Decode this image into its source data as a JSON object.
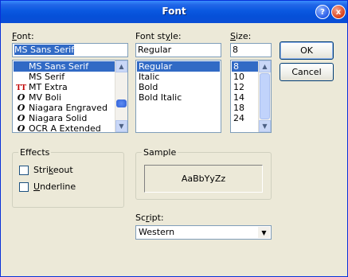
{
  "window": {
    "title": "Font",
    "help_glyph": "?",
    "close_glyph": "x"
  },
  "font": {
    "label_u": "F",
    "label_rest": "ont:",
    "value": "MS Sans Serif",
    "items": [
      {
        "name": "MS Sans Serif",
        "icon": "",
        "selected": true
      },
      {
        "name": "MS Serif",
        "icon": "",
        "selected": false
      },
      {
        "name": "MT Extra",
        "icon": "TT",
        "selected": false
      },
      {
        "name": "MV Boli",
        "icon": "O",
        "selected": false
      },
      {
        "name": "Niagara Engraved",
        "icon": "O",
        "selected": false
      },
      {
        "name": "Niagara Solid",
        "icon": "O",
        "selected": false
      },
      {
        "name": "OCR A Extended",
        "icon": "O",
        "selected": false
      }
    ]
  },
  "style": {
    "label_pre": "Font st",
    "label_u": "y",
    "label_post": "le:",
    "value": "Regular",
    "items": [
      {
        "name": "Regular",
        "selected": true
      },
      {
        "name": "Italic",
        "selected": false
      },
      {
        "name": "Bold",
        "selected": false
      },
      {
        "name": "Bold Italic",
        "selected": false
      }
    ]
  },
  "size": {
    "label_u": "S",
    "label_rest": "ize:",
    "value": "8",
    "items": [
      {
        "name": "8",
        "selected": true
      },
      {
        "name": "10",
        "selected": false
      },
      {
        "name": "12",
        "selected": false
      },
      {
        "name": "14",
        "selected": false
      },
      {
        "name": "18",
        "selected": false
      },
      {
        "name": "24",
        "selected": false
      }
    ]
  },
  "buttons": {
    "ok": "OK",
    "cancel": "Cancel"
  },
  "effects": {
    "label": "Effects",
    "strikeout_u": "k",
    "strikeout_pre": "Stri",
    "strikeout_post": "eout",
    "underline_u": "U",
    "underline_rest": "nderline"
  },
  "sample": {
    "label": "Sample",
    "text": "AaBbYyZz"
  },
  "script": {
    "label_pre": "Sc",
    "label_u": "r",
    "label_post": "ipt:",
    "value": "Western"
  },
  "colors": {
    "selection": "#316ac5",
    "titlebar": "#0a58e0",
    "dialog": "#ece9d8"
  }
}
